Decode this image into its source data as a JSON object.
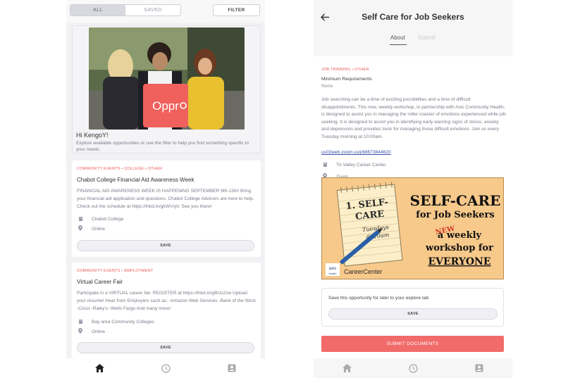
{
  "left": {
    "segments": [
      "ALL",
      "SAVED"
    ],
    "filter_label": "FILTER",
    "welcome": {
      "brand_badge": "Oppr",
      "title": "Hi KengoY!",
      "text": "Explore available opportunities or use the filter to help you find something specific to your needs."
    },
    "cards": [
      {
        "tags": "COMMUNITY EVENTS • COLLEGE • OTHER",
        "title": "Chabot College Financial Aid Awareness Week",
        "description": "FINANCIAL AID AWARENESS WEEK IS HAPPENING SEPTEMBER 9th-13th! Bring your financial aid application and questions. Chabot College Advisors are here to help. Check out the schedule at https://lnkd.in/gkWVxjV. See you there!",
        "organization": "Chabot College",
        "location": "Online",
        "save_label": "SAVE"
      },
      {
        "tags": "COMMUNITY EVENTS • EMPLOYMENT",
        "title": "Virtual Career Fair",
        "description": "Participate in a VIRTUAL career fair. REGISTER at https://lnkd.in/gBUs2sw Upload your resume! Hear from Employers such as: -Amazon Web Services -Bank of the West -Cisco -Raley's -Wells Fargo And many more!",
        "organization": "Bay area Community Colleges",
        "location": "Online",
        "save_label": "SAVE"
      }
    ],
    "nav": [
      "home-icon",
      "clock-icon",
      "profile-icon"
    ]
  },
  "right": {
    "title": "Self Care for Job Seekers",
    "tabs": [
      "About",
      "Submit"
    ],
    "tags": "JOB TRAINING • OTHER",
    "requirements_label": "Minimum Requirements",
    "requirements_value": "None",
    "description": "Job searching can be a time of exciting possibilities and a time of difficult disappointments. This new, weekly workshop, in partnership with Axis Community Health, is designed to assist you in managing the roller coaster of emotions experienced while job seeking. It is designed to assist you in identifying early warning signs of stress, anxiety and depression and provides tools for managing those difficult emotions. Join us every Tuesday morning at 10:00am.",
    "link": "us02web.zoom.us/j/88573844620",
    "organization": "Tri-Valley Career Center",
    "location": "Zoom",
    "banner": {
      "note_line1": "1. SELF-",
      "note_line2": "CARE",
      "note_line3": "Tuesdays",
      "note_line4": "@ 10am",
      "headline1": "SELF-CARE",
      "headline2": "for Job Seekers",
      "new_label": "NEW",
      "sub1": "a weekly",
      "sub2": "workshop for",
      "sub3": "EVERYONE",
      "logo1": "axis",
      "logo1b": "health",
      "logo2": "CareerCenter"
    },
    "save_prompt": "Save this opportunity for later to your explore tab",
    "save_label": "SAVE",
    "submit_label": "SUBMIT DOCUMENTS",
    "nav": [
      "home-icon",
      "clock-icon",
      "profile-icon"
    ]
  },
  "colors": {
    "accent": "#f26b6b",
    "tag_red": "#e85858",
    "link_blue": "#3a4fa8",
    "banner_bg": "#f7c98b"
  }
}
